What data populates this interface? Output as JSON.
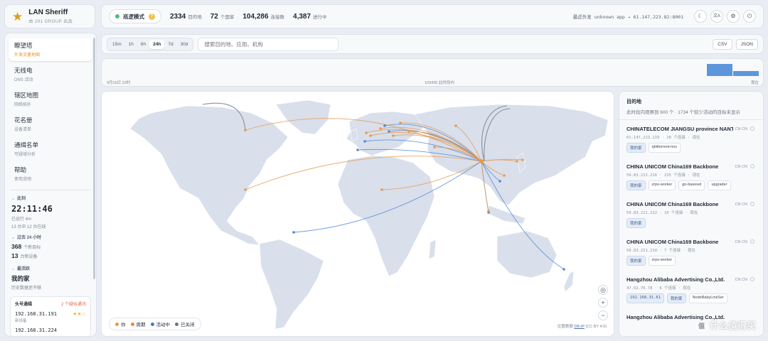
{
  "brand": {
    "name": "LAN Sheriff",
    "sub": "由 291 GROUP 出品"
  },
  "topbar": {
    "mode_label": "巡逻模式",
    "mode_hint": "?",
    "stats": [
      {
        "num": "2334",
        "label": "目的地"
      },
      {
        "num": "72",
        "label": "个国家"
      },
      {
        "num": "104,286",
        "label": "连接数"
      },
      {
        "num": "4,387",
        "label": "进行中"
      }
    ],
    "recent_key": "最近外发",
    "recent_value": "unknown app → 61.147.223.82:8001",
    "icons": [
      "☾",
      "文A",
      "⚙",
      "⏻"
    ]
  },
  "sidebar": {
    "nav": [
      {
        "title": "瞭望塔",
        "sub": "外发流量地图",
        "active": true
      },
      {
        "title": "无线电",
        "sub": "DNS 活动",
        "active": false
      },
      {
        "title": "辖区地图",
        "sub": "网络拓扑",
        "active": false
      },
      {
        "title": "花名册",
        "sub": "设备清单",
        "active": false
      },
      {
        "title": "通缉名单",
        "sub": "可疑域分析",
        "active": false
      },
      {
        "title": "帮助",
        "sub": "使用说明",
        "active": false
      }
    ],
    "now_header": "此刻",
    "clock": "22:11:46",
    "uptime": "已运行 4m",
    "online": "13 台中 12 台在线",
    "past_header": "过去 24 小时",
    "new_targets_num": "368",
    "new_targets_label": "个新目标",
    "new_devices_num": "13",
    "new_devices_label": "台新设备",
    "latest_header": "最活跃",
    "latest_name": "我的家",
    "latest_sub": "历史数据还不够",
    "hosts_title": "头号通缉",
    "hosts_warn": "2 个疑似通讯",
    "hosts": [
      {
        "ip": "192.168.31.191",
        "sub": "新设备",
        "stars": "★★☆"
      },
      {
        "ip": "192.168.31.224",
        "sub": "",
        "stars": ""
      }
    ]
  },
  "filter": {
    "ranges": [
      "15m",
      "1h",
      "6h",
      "24h",
      "7d",
      "30d"
    ],
    "active_range": "24h",
    "search_placeholder": "搜索目的地、应用、机构",
    "exports": [
      "CSV",
      "JSON"
    ]
  },
  "timeline": {
    "start": "9月16日 22时",
    "mid": "103435 此时段内",
    "end": "现在"
  },
  "map": {
    "legend": [
      {
        "label": "你",
        "color": "#e99a3a"
      },
      {
        "label": "周期",
        "color": "#e98a36"
      },
      {
        "label": "活动中",
        "color": "#3f7bd2"
      },
      {
        "label": "已关闭",
        "color": "#6d7684"
      }
    ],
    "attribution_prefix": "位置数据",
    "attribution_link": "DB-IP",
    "attribution_suffix": "(CC BY 4.0)",
    "zoom_buttons": [
      "◎",
      "+",
      "−"
    ],
    "land_color": "#d9dfeb",
    "arc_orange": "#e89b52",
    "arc_blue": "#4d8ad8"
  },
  "destinations": {
    "title": "目的地",
    "subtitle": "此时段内观察到 600 个 · 1734 个较少活动的目标未显示",
    "items": [
      {
        "name": "CHINATELECOM JIANGSU province NANTONG",
        "meta": "61.147.223.119 · 28 个连接 · 现在",
        "cc": "CN  CN",
        "chips": [
          {
            "t": "我的家",
            "c": "blue"
          },
          {
            "t": "qbittorrent-nox",
            "c": ""
          }
        ]
      },
      {
        "name": "CHINA UNICOM China169 Backbone",
        "meta": "59.83.211.216 · 235 个连接 · 现在",
        "cc": "CN  CN",
        "chips": [
          {
            "t": "我的家",
            "c": "blue"
          },
          {
            "t": "zrps-worker",
            "c": ""
          },
          {
            "t": "go-baseset",
            "c": ""
          },
          {
            "t": "upgrader",
            "c": ""
          }
        ]
      },
      {
        "name": "CHINA UNICOM China169 Backbone",
        "meta": "59.83.211.212 · 10 个连接 · 现在",
        "cc": "CN  CN",
        "chips": [
          {
            "t": "我的家",
            "c": "blue"
          }
        ]
      },
      {
        "name": "CHINA UNICOM China169 Backbone",
        "meta": "59.83.211.210 · 7 个连接 · 现在",
        "cc": "CN  CN",
        "chips": [
          {
            "t": "我的家",
            "c": "blue"
          },
          {
            "t": "zrps-worker",
            "c": ""
          }
        ]
      },
      {
        "name": "Hangzhou Alibaba Advertising Co.,Ltd.",
        "meta": "47.92.76.78 · 6 个连接 · 现在",
        "cc": "CN  CN",
        "chips": [
          {
            "t": "192.168.31.61",
            "c": "blue mono"
          },
          {
            "t": "我的家",
            "c": "blue"
          },
          {
            "t": "NodeBabyLinkSer",
            "c": ""
          }
        ]
      },
      {
        "name": "Hangzhou Alibaba Advertising Co.,Ltd.",
        "meta": "",
        "cc": "",
        "chips": []
      }
    ]
  },
  "watermark": {
    "icon": "值",
    "text": "什么值得买"
  }
}
